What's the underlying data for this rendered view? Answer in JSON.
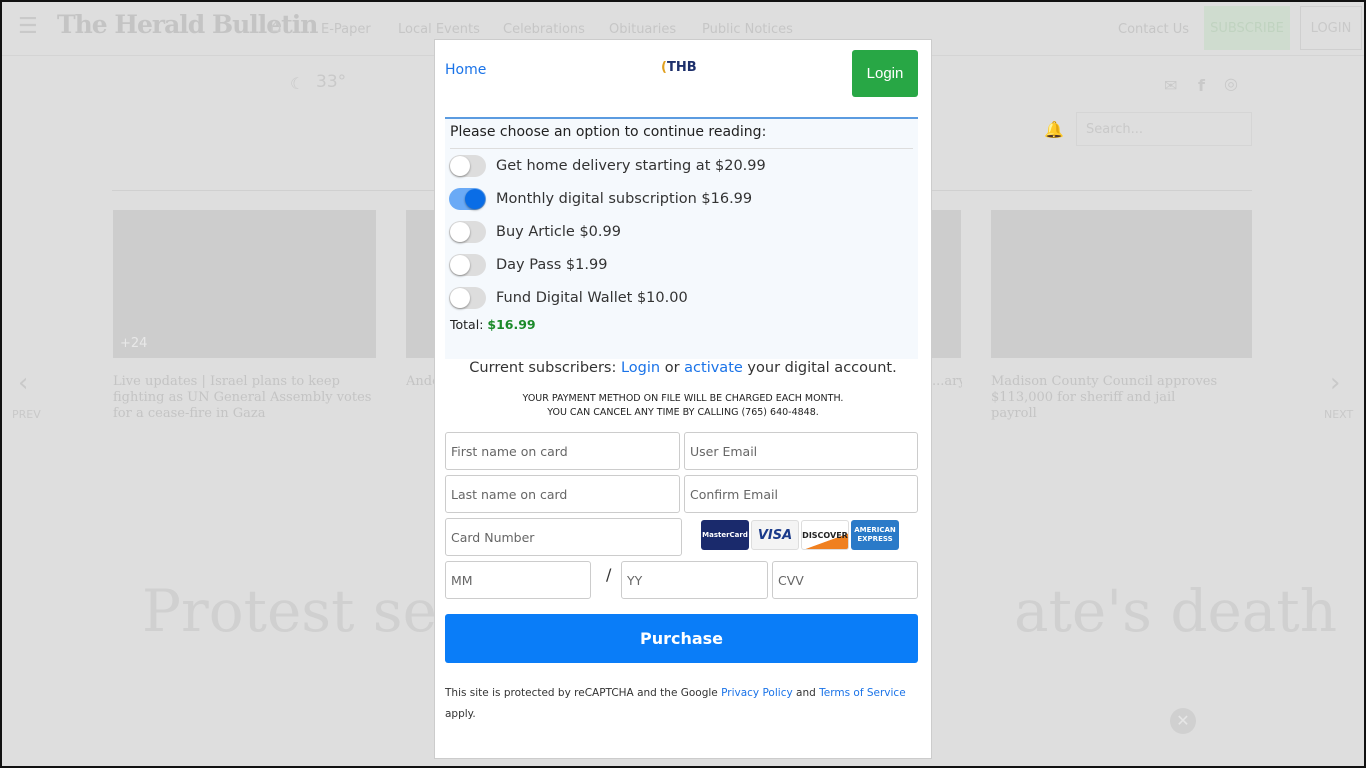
{
  "background": {
    "logo": "The Herald Bulletin",
    "nav": [
      "E-Paper",
      "Local Events",
      "Celebrations",
      "Obituaries",
      "Public Notices"
    ],
    "contact": "Contact Us",
    "subscribe": "SUBSCRIBE",
    "login": "LOGIN",
    "weather": "33°",
    "search_placeholder": "Search...",
    "photo_count": "+24",
    "prev": "PREV",
    "next": "NEXT",
    "articles": [
      "Live updates | Israel plans to keep fighting as UN General Assembly votes for a cease-fire in Gaza",
      "Ande... after...",
      "...ary;",
      "Madison County Council approves $113,000 for sheriff and jail payroll"
    ],
    "headline_left": "Protest see",
    "headline_right": "ate's death"
  },
  "modal": {
    "home": "Home",
    "logo": "THB",
    "login": "Login",
    "prompt": "Please choose an option to continue reading:",
    "options": [
      {
        "label": "Get home delivery starting at $20.99",
        "selected": false
      },
      {
        "label": "Monthly digital subscription $16.99",
        "selected": true
      },
      {
        "label": "Buy Article $0.99",
        "selected": false
      },
      {
        "label": "Day Pass $1.99",
        "selected": false
      },
      {
        "label": "Fund Digital Wallet $10.00",
        "selected": false
      }
    ],
    "total_label": "Total:",
    "total_value": "$16.99",
    "current": {
      "prefix": "Current subscribers:",
      "login": "Login",
      "or": "or",
      "activate": "activate",
      "suffix": "your digital account."
    },
    "notice1": "YOUR PAYMENT METHOD ON FILE WILL BE CHARGED EACH MONTH.",
    "notice2": "YOU CAN CANCEL ANY TIME BY CALLING (765) 640-4848.",
    "fields": {
      "first": "First name on card",
      "email": "User Email",
      "last": "Last name on card",
      "confirm": "Confirm Email",
      "card": "Card Number",
      "mm": "MM",
      "yy": "YY",
      "cvv": "CVV"
    },
    "slash": "/",
    "card_brands": [
      "MasterCard",
      "VISA",
      "DISCOVER",
      "AMERICAN EXPRESS"
    ],
    "purchase": "Purchase",
    "footer": {
      "text": "This site is protected by reCAPTCHA and the Google",
      "privacy": "Privacy Policy",
      "and": "and",
      "terms": "Terms of Service",
      "apply": "apply."
    },
    "colors": {
      "accent": "#0a7df8",
      "login": "#28a745",
      "total": "#1b8a2a"
    }
  }
}
